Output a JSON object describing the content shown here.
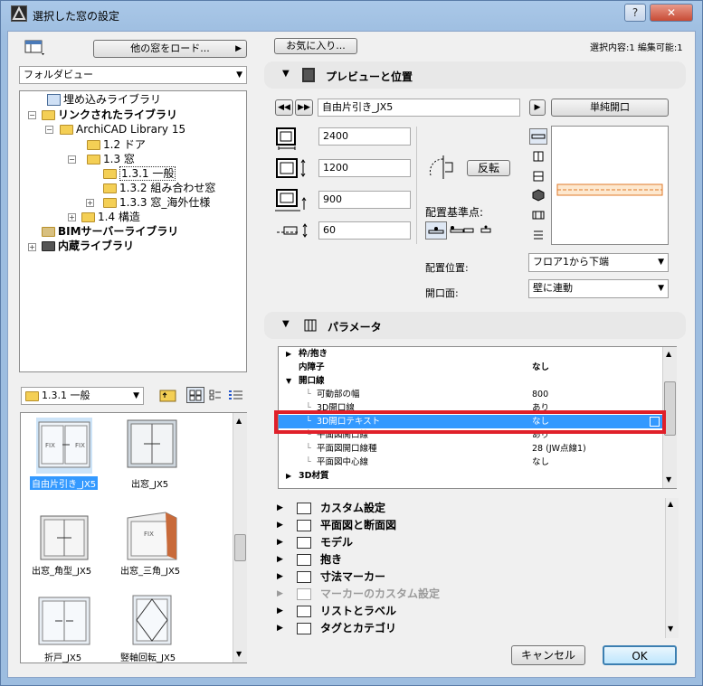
{
  "window": {
    "title": "選択した窓の設定"
  },
  "left": {
    "load_other_label": "他の窓をロード...",
    "view_combo": "フォルダビュー",
    "tree": [
      {
        "label": "埋め込みライブラリ",
        "bold": false
      },
      {
        "label": "リンクされたライブラリ",
        "bold": true
      },
      {
        "label": "ArchiCAD Library 15",
        "bold": false
      },
      {
        "label": "1.2 ドア",
        "bold": false
      },
      {
        "label": "1.3 窓",
        "bold": false
      },
      {
        "label": "1.3.1 一般",
        "bold": false
      },
      {
        "label": "1.3.2 組み合わせ窓",
        "bold": false
      },
      {
        "label": "1.3.3 窓_海外仕様",
        "bold": false
      },
      {
        "label": "1.4 構造",
        "bold": false
      },
      {
        "label": "BIMサーバーライブラリ",
        "bold": true
      },
      {
        "label": "内蔵ライブラリ",
        "bold": true
      }
    ],
    "folder_combo": "1.3.1 一般",
    "objects": [
      {
        "label": "自由片引き_JX5",
        "selected": true
      },
      {
        "label": "出窓_JX5",
        "selected": false
      },
      {
        "label": "出窓_角型_JX5",
        "selected": false
      },
      {
        "label": "出窓_三角_JX5",
        "selected": false
      },
      {
        "label": "折戸_JX5",
        "selected": false
      },
      {
        "label": "竪軸回転_JX5",
        "selected": false
      }
    ]
  },
  "right": {
    "favorites_label": "お気に入り...",
    "selection_info": "選択内容:1 編集可能:1",
    "preview": {
      "title": "プレビューと位置",
      "object_name": "自由片引き_JX5",
      "type_button": "単純開口",
      "width": "2400",
      "height": "1200",
      "sill": "900",
      "reveal": "60",
      "flip_label": "反転",
      "anchor_label": "配置基準点:",
      "placement_label": "配置位置:",
      "placement_value": "フロア1から下端",
      "opening_label": "開口面:",
      "opening_value": "壁に連動"
    },
    "params": {
      "title": "パラメータ",
      "rows": [
        {
          "label": "枠/抱き",
          "value": "",
          "level": 0,
          "group": true,
          "expanded": false
        },
        {
          "label": "内障子",
          "value": "なし",
          "level": 1,
          "group": false,
          "bold": true
        },
        {
          "label": "開口線",
          "value": "",
          "level": 0,
          "group": true,
          "expanded": true
        },
        {
          "label": "可動部の幅",
          "value": "800",
          "level": 2,
          "group": false
        },
        {
          "label": "3D開口線",
          "value": "あり",
          "level": 2,
          "group": false
        },
        {
          "label": "3D開口テキスト",
          "value": "なし",
          "level": 2,
          "group": false,
          "selected": true
        },
        {
          "label": "平面図開口線",
          "value": "あり",
          "level": 2,
          "group": false
        },
        {
          "label": "平面図開口線種",
          "value": "28 (JW点線1)",
          "level": 2,
          "group": false
        },
        {
          "label": "平面図中心線",
          "value": "なし",
          "level": 2,
          "group": false
        },
        {
          "label": "3D材質",
          "value": "",
          "level": 0,
          "group": true,
          "expanded": false
        }
      ]
    },
    "sections": [
      {
        "label": "カスタム設定",
        "disabled": false
      },
      {
        "label": "平面図と断面図",
        "disabled": false
      },
      {
        "label": "モデル",
        "disabled": false
      },
      {
        "label": "抱き",
        "disabled": false
      },
      {
        "label": "寸法マーカー",
        "disabled": false
      },
      {
        "label": "マーカーのカスタム設定",
        "disabled": true
      },
      {
        "label": "リストとラベル",
        "disabled": false
      },
      {
        "label": "タグとカテゴリ",
        "disabled": false
      }
    ],
    "cancel_label": "キャンセル",
    "ok_label": "OK"
  },
  "colors": {
    "selection": "#3399ff",
    "highlight_box": "#e0202a"
  }
}
